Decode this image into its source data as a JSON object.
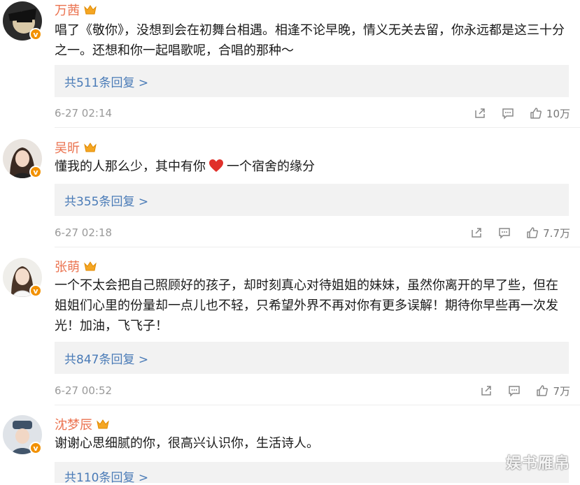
{
  "comments": [
    {
      "name": "万茜",
      "content": "唱了《敬你》，没想到会在初舞台相遇。相逢不论早晚，情义无关去留，你永远都是这三十分之一。还想和你一起唱歌呢，合唱的那种～",
      "replies": "共511条回复 >",
      "time": "6-27 02:14",
      "likes": "10万"
    },
    {
      "name": "吴昕",
      "content_before": "懂我的人那么少，其中有你",
      "content_after": "一个宿舍的缘分",
      "replies": "共355条回复 >",
      "time": "6-27 02:18",
      "likes": "7.7万"
    },
    {
      "name": "张萌",
      "content": "一个不太会把自己照顾好的孩子，却时刻真心对待姐姐的妹妹，虽然你离开的早了些，但在姐姐们心里的份量却一点儿也不轻，只希望外界不再对你有更多误解！期待你早些再一次发光！加油，飞飞子！",
      "replies": "共847条回复 >",
      "time": "6-27 00:52",
      "likes": "7万"
    },
    {
      "name": "沈梦辰",
      "content": "谢谢心思细腻的你，很高兴认识你，生活诗人。",
      "replies": "共110条回复 >"
    }
  ],
  "badge": "v",
  "watermark": "娱书雁帛",
  "colors": {
    "name": "#eb7350",
    "link": "#4a7bb7",
    "meta": "#999999",
    "reply_bg": "#f2f2f2",
    "badge": "#f29100"
  },
  "icons": {
    "share": "share-icon",
    "comment": "comment-icon",
    "like": "thumbs-up-icon",
    "crown": "crown-icon",
    "heart": "heart-icon"
  }
}
